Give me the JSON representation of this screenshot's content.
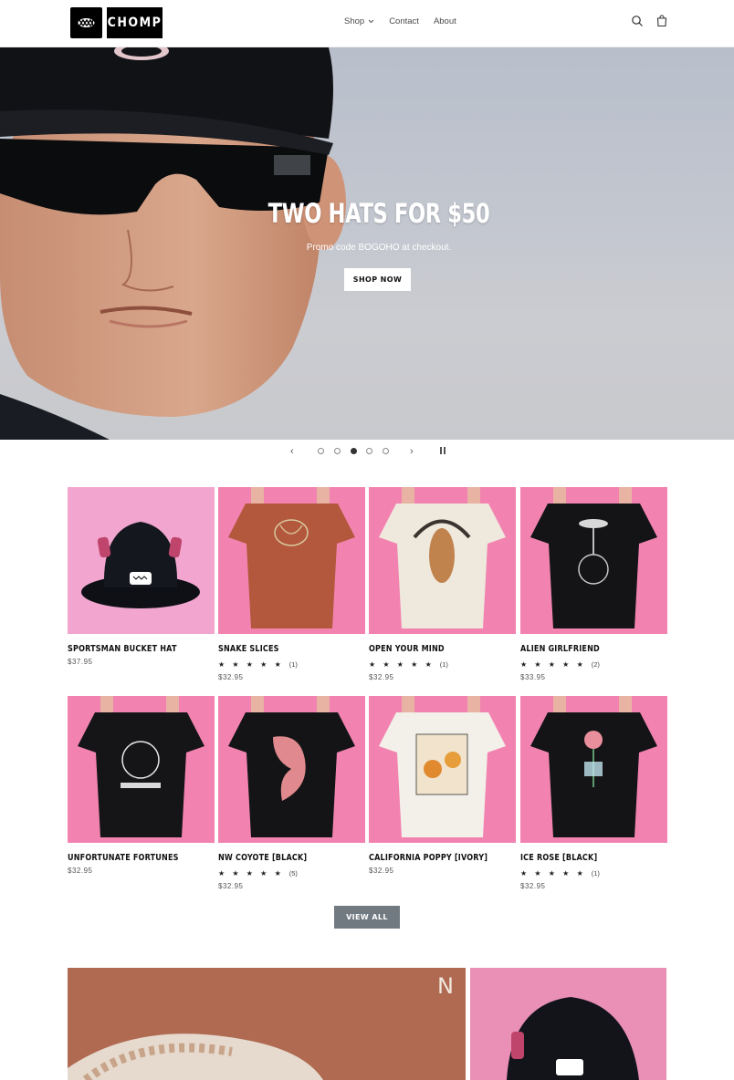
{
  "header": {
    "logo_text": "CHOMP",
    "nav": [
      {
        "label": "Shop"
      },
      {
        "label": "Contact"
      },
      {
        "label": "About"
      }
    ],
    "search_icon": "search-icon",
    "cart_icon": "cart-icon"
  },
  "hero": {
    "title": "TWO HATS FOR $50",
    "subtitle": "Promo code BOGOHO at checkout.",
    "button": "SHOP NOW"
  },
  "slider": {
    "slide_count": 5,
    "active_slide": 3
  },
  "products": [
    {
      "title": "SPORTSMAN BUCKET HAT",
      "stars": "",
      "count": "",
      "price": "$37.95"
    },
    {
      "title": "SNAKE SLICES",
      "stars": "★ ★ ★ ★ ★",
      "count": "(1)",
      "price": "$32.95"
    },
    {
      "title": "OPEN YOUR MIND",
      "stars": "★ ★ ★ ★ ★",
      "count": "(1)",
      "price": "$32.95"
    },
    {
      "title": "ALIEN GIRLFRIEND",
      "stars": "★ ★ ★ ★ ★",
      "count": "(2)",
      "price": "$33.95"
    },
    {
      "title": "UNFORTUNATE FORTUNES",
      "stars": "",
      "count": "",
      "price": "$32.95"
    },
    {
      "title": "NW COYOTE [BLACK]",
      "stars": "★ ★ ★ ★ ★",
      "count": "(5)",
      "price": "$32.95"
    },
    {
      "title": "CALIFORNIA POPPY [IVORY]",
      "stars": "",
      "count": "",
      "price": "$32.95"
    },
    {
      "title": "ICE ROSE [BLACK]",
      "stars": "★ ★ ★ ★ ★",
      "count": "(1)",
      "price": "$32.95"
    }
  ],
  "view_all": "VIEW ALL",
  "colors": {
    "hero_bg": "#c3c7d0",
    "product_bg": "#f283b0",
    "view_all_bg": "#727a81"
  }
}
